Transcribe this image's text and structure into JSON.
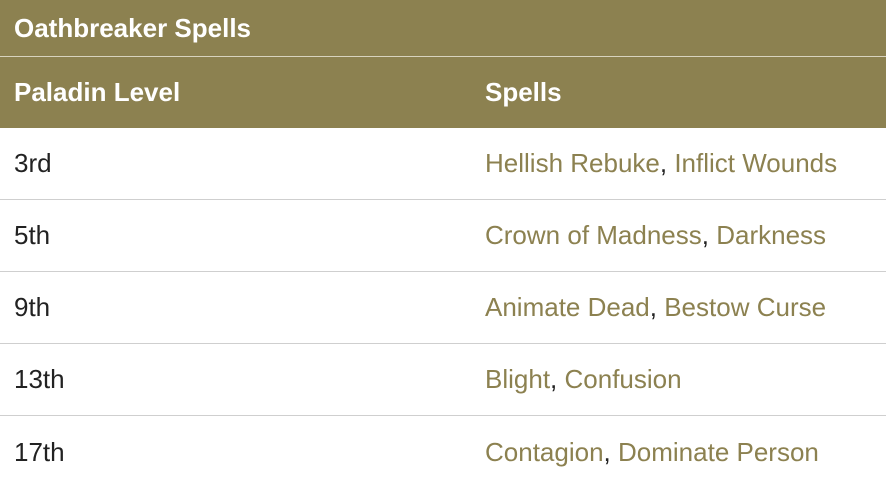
{
  "table": {
    "caption": "Oathbreaker Spells",
    "headers": {
      "level": "Paladin Level",
      "spells": "Spells"
    },
    "rows": [
      {
        "level": "3rd",
        "spell1": "Hellish Rebuke",
        "spell2": "Inflict Wounds"
      },
      {
        "level": "5th",
        "spell1": "Crown of Madness",
        "spell2": "Darkness"
      },
      {
        "level": "9th",
        "spell1": "Animate Dead",
        "spell2": "Bestow Curse"
      },
      {
        "level": "13th",
        "spell1": "Blight",
        "spell2": "Confusion"
      },
      {
        "level": "17th",
        "spell1": "Contagion",
        "spell2": "Dominate Person"
      }
    ],
    "separator": ", ",
    "colors": {
      "header_bg": "#8c8150",
      "link": "#8c8150",
      "text": "#222222"
    }
  }
}
